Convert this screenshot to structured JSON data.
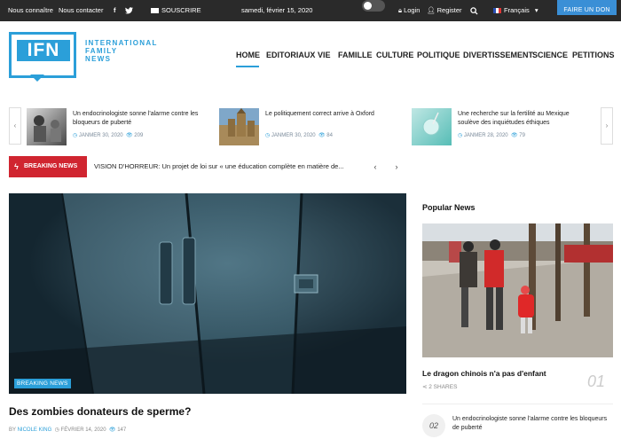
{
  "topbar": {
    "about": "Nous connaître",
    "contact": "Nous contacter",
    "facebook_icon": "f",
    "twitter_icon": "🐦",
    "subscribe": "SOUSCRIRE",
    "date": "samedi, février 15, 2020",
    "login": "Login",
    "register": "Register",
    "language": "Français",
    "donate": "FAIRE UN DON"
  },
  "logo": {
    "mark": "IFN",
    "line1": "INTERNATIONAL",
    "line2": "FAMILY",
    "line3": "NEWS"
  },
  "nav": [
    "HOME",
    "EDITORIAUX",
    "VIE",
    "FAMILLE",
    "CULTURE",
    "POLITIQUE",
    "DIVERTISSEMENT",
    "SCIENCE",
    "PETITIONS"
  ],
  "ticker": [
    {
      "title": "Un endocrinologiste sonne l'alarme contre les bloqueurs de puberté",
      "date": "JANMER 30, 2020",
      "views": "209"
    },
    {
      "title": "Le politiquement correct arrive à Oxford",
      "date": "JANMER 30, 2020",
      "views": "84"
    },
    {
      "title": "Une recherche sur la fertilité au Mexique soulève des inquiétudes éthiques",
      "date": "JANMER 28, 2020",
      "views": "79"
    }
  ],
  "breaking": {
    "label": "BREAKING NEWS",
    "text": "VISION D'HORREUR: Un projet de loi sur « une éducation complète en matière de..."
  },
  "hero": {
    "badge": "BREAKING NEWS",
    "title": "Des zombies donateurs de sperme?",
    "by": "BY",
    "author": "NICOLE KING",
    "date": "FÉVRIER 14, 2020",
    "views": "147"
  },
  "popular": {
    "heading": "Popular News",
    "items": [
      {
        "num": "01",
        "title": "Le dragon chinois n'a pas d'enfant",
        "shares": "2 SHARES"
      },
      {
        "num": "02",
        "title": "Un endocrinologiste sonne l'alarme contre les bloqueurs de puberté"
      }
    ]
  }
}
